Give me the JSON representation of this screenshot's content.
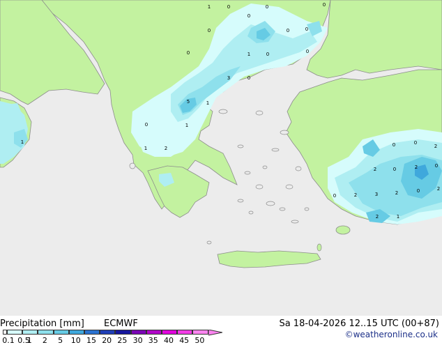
{
  "title": "Precipitation [mm]",
  "model": "ECMWF",
  "datetime": "Sa 18-04-2026 12..15 UTC (00+87)",
  "credit": "©weatheronline.co.uk",
  "colors": {
    "sea": "#ececec",
    "land_dry": "#ececec",
    "land_wet": "#c3f2a0",
    "coast": "#8c8c8c",
    "precip_0_1": "#d6fcfc",
    "precip_0_5": "#afeef2",
    "precip_1": "#8ee0ec",
    "precip_2": "#66cbe4",
    "precip_5": "#3fa8dc"
  },
  "legend": {
    "ticks": [
      "0.1",
      "0.5",
      "1",
      "2",
      "5",
      "10",
      "15",
      "20",
      "25",
      "30",
      "35",
      "40",
      "45",
      "50"
    ],
    "colors": [
      "#ffffff",
      "#d6fcfc",
      "#afeef2",
      "#8ee0ec",
      "#66cbe4",
      "#3fa8dc",
      "#2a72d0",
      "#1f3fb7",
      "#16169e",
      "#7a06b5",
      "#b006c8",
      "#e005dc",
      "#f23de6",
      "#ff84f0"
    ]
  },
  "value_labels": [
    "1",
    "0",
    "0",
    "0",
    "0",
    "0",
    "0",
    "0",
    "1",
    "0",
    "0",
    "0",
    "3",
    "0",
    "5",
    "1",
    "0",
    "1",
    "1",
    "2",
    "1",
    "0",
    "0",
    "2",
    "2",
    "0",
    "2",
    "0",
    "3",
    "2",
    "0",
    "2",
    "0",
    "2",
    "2",
    "1"
  ]
}
